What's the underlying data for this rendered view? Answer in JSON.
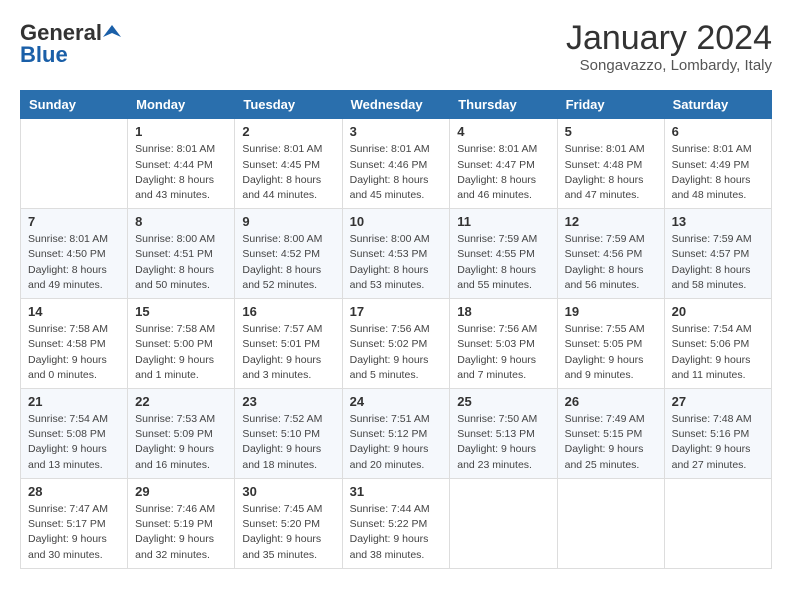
{
  "header": {
    "logo_general": "General",
    "logo_blue": "Blue",
    "month_title": "January 2024",
    "subtitle": "Songavazzo, Lombardy, Italy"
  },
  "calendar": {
    "headers": [
      "Sunday",
      "Monday",
      "Tuesday",
      "Wednesday",
      "Thursday",
      "Friday",
      "Saturday"
    ],
    "weeks": [
      [
        {
          "day": "",
          "info": ""
        },
        {
          "day": "1",
          "info": "Sunrise: 8:01 AM\nSunset: 4:44 PM\nDaylight: 8 hours\nand 43 minutes."
        },
        {
          "day": "2",
          "info": "Sunrise: 8:01 AM\nSunset: 4:45 PM\nDaylight: 8 hours\nand 44 minutes."
        },
        {
          "day": "3",
          "info": "Sunrise: 8:01 AM\nSunset: 4:46 PM\nDaylight: 8 hours\nand 45 minutes."
        },
        {
          "day": "4",
          "info": "Sunrise: 8:01 AM\nSunset: 4:47 PM\nDaylight: 8 hours\nand 46 minutes."
        },
        {
          "day": "5",
          "info": "Sunrise: 8:01 AM\nSunset: 4:48 PM\nDaylight: 8 hours\nand 47 minutes."
        },
        {
          "day": "6",
          "info": "Sunrise: 8:01 AM\nSunset: 4:49 PM\nDaylight: 8 hours\nand 48 minutes."
        }
      ],
      [
        {
          "day": "7",
          "info": "Sunrise: 8:01 AM\nSunset: 4:50 PM\nDaylight: 8 hours\nand 49 minutes."
        },
        {
          "day": "8",
          "info": "Sunrise: 8:00 AM\nSunset: 4:51 PM\nDaylight: 8 hours\nand 50 minutes."
        },
        {
          "day": "9",
          "info": "Sunrise: 8:00 AM\nSunset: 4:52 PM\nDaylight: 8 hours\nand 52 minutes."
        },
        {
          "day": "10",
          "info": "Sunrise: 8:00 AM\nSunset: 4:53 PM\nDaylight: 8 hours\nand 53 minutes."
        },
        {
          "day": "11",
          "info": "Sunrise: 7:59 AM\nSunset: 4:55 PM\nDaylight: 8 hours\nand 55 minutes."
        },
        {
          "day": "12",
          "info": "Sunrise: 7:59 AM\nSunset: 4:56 PM\nDaylight: 8 hours\nand 56 minutes."
        },
        {
          "day": "13",
          "info": "Sunrise: 7:59 AM\nSunset: 4:57 PM\nDaylight: 8 hours\nand 58 minutes."
        }
      ],
      [
        {
          "day": "14",
          "info": "Sunrise: 7:58 AM\nSunset: 4:58 PM\nDaylight: 9 hours\nand 0 minutes."
        },
        {
          "day": "15",
          "info": "Sunrise: 7:58 AM\nSunset: 5:00 PM\nDaylight: 9 hours\nand 1 minute."
        },
        {
          "day": "16",
          "info": "Sunrise: 7:57 AM\nSunset: 5:01 PM\nDaylight: 9 hours\nand 3 minutes."
        },
        {
          "day": "17",
          "info": "Sunrise: 7:56 AM\nSunset: 5:02 PM\nDaylight: 9 hours\nand 5 minutes."
        },
        {
          "day": "18",
          "info": "Sunrise: 7:56 AM\nSunset: 5:03 PM\nDaylight: 9 hours\nand 7 minutes."
        },
        {
          "day": "19",
          "info": "Sunrise: 7:55 AM\nSunset: 5:05 PM\nDaylight: 9 hours\nand 9 minutes."
        },
        {
          "day": "20",
          "info": "Sunrise: 7:54 AM\nSunset: 5:06 PM\nDaylight: 9 hours\nand 11 minutes."
        }
      ],
      [
        {
          "day": "21",
          "info": "Sunrise: 7:54 AM\nSunset: 5:08 PM\nDaylight: 9 hours\nand 13 minutes."
        },
        {
          "day": "22",
          "info": "Sunrise: 7:53 AM\nSunset: 5:09 PM\nDaylight: 9 hours\nand 16 minutes."
        },
        {
          "day": "23",
          "info": "Sunrise: 7:52 AM\nSunset: 5:10 PM\nDaylight: 9 hours\nand 18 minutes."
        },
        {
          "day": "24",
          "info": "Sunrise: 7:51 AM\nSunset: 5:12 PM\nDaylight: 9 hours\nand 20 minutes."
        },
        {
          "day": "25",
          "info": "Sunrise: 7:50 AM\nSunset: 5:13 PM\nDaylight: 9 hours\nand 23 minutes."
        },
        {
          "day": "26",
          "info": "Sunrise: 7:49 AM\nSunset: 5:15 PM\nDaylight: 9 hours\nand 25 minutes."
        },
        {
          "day": "27",
          "info": "Sunrise: 7:48 AM\nSunset: 5:16 PM\nDaylight: 9 hours\nand 27 minutes."
        }
      ],
      [
        {
          "day": "28",
          "info": "Sunrise: 7:47 AM\nSunset: 5:17 PM\nDaylight: 9 hours\nand 30 minutes."
        },
        {
          "day": "29",
          "info": "Sunrise: 7:46 AM\nSunset: 5:19 PM\nDaylight: 9 hours\nand 32 minutes."
        },
        {
          "day": "30",
          "info": "Sunrise: 7:45 AM\nSunset: 5:20 PM\nDaylight: 9 hours\nand 35 minutes."
        },
        {
          "day": "31",
          "info": "Sunrise: 7:44 AM\nSunset: 5:22 PM\nDaylight: 9 hours\nand 38 minutes."
        },
        {
          "day": "",
          "info": ""
        },
        {
          "day": "",
          "info": ""
        },
        {
          "day": "",
          "info": ""
        }
      ]
    ]
  }
}
